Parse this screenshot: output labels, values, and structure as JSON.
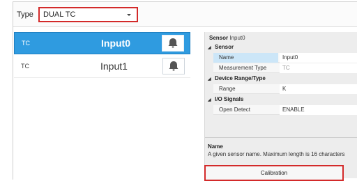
{
  "type_bar": {
    "label": "Type",
    "selected_value": "DUAL TC"
  },
  "inputs": [
    {
      "type": "TC",
      "name": "Input0",
      "selected": true,
      "alarm_icon": "bell-icon"
    },
    {
      "type": "TC",
      "name": "Input1",
      "selected": false,
      "alarm_icon": "bell-icon"
    }
  ],
  "properties": {
    "header_label": "Sensor",
    "header_value": "Input0",
    "categories": {
      "sensor": "Sensor",
      "device_range": "Device Range/Type",
      "io_signals": "I/O Signals"
    },
    "rows": {
      "name": {
        "key": "Name",
        "value": "Input0"
      },
      "measurement_type": {
        "key": "Measurement Type",
        "value": "TC"
      },
      "range": {
        "key": "Range",
        "value": "K"
      },
      "open_detect": {
        "key": "Open Detect",
        "value": "ENABLE"
      }
    },
    "description_title": "Name",
    "description_text": "A given sensor name. Maximum length is 16 characters"
  },
  "calibration_button": "Calibration",
  "colors": {
    "selection_blue": "#2f9be0",
    "highlight_red": "#d32a2a",
    "panel_gray": "#ededed"
  }
}
